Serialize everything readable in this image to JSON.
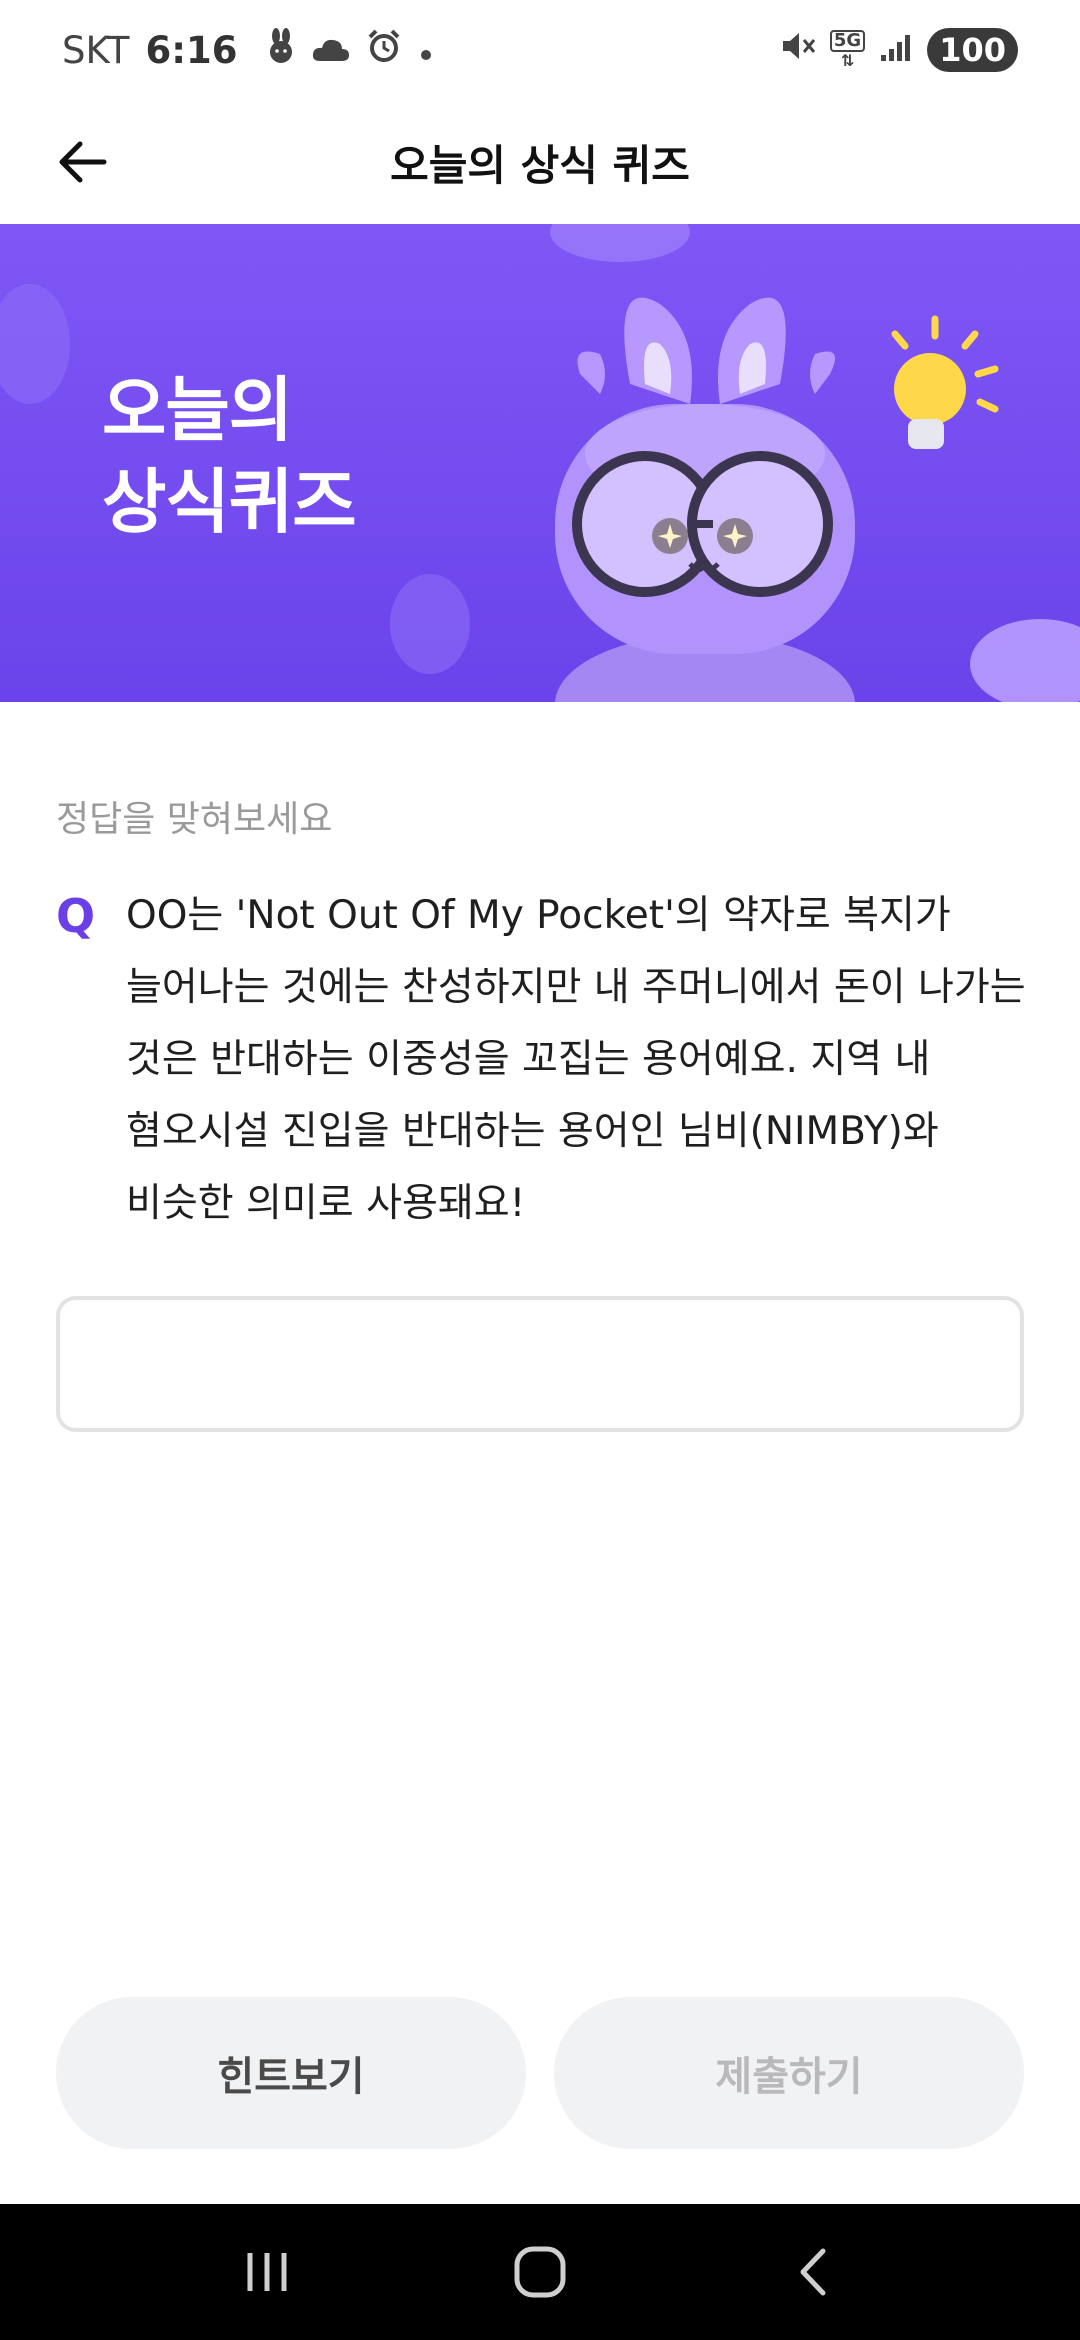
{
  "status_bar": {
    "carrier": "SKT",
    "time": "6:16",
    "network": "5G",
    "battery": "100",
    "icons": [
      "rabbit-icon",
      "cloud-icon",
      "alarm-icon",
      "dot-icon",
      "mute-icon",
      "network-5g-icon",
      "signal-icon",
      "battery-icon"
    ]
  },
  "header": {
    "title": "오늘의 상식 퀴즈",
    "back_icon": "arrow-left-icon"
  },
  "banner": {
    "line1": "오늘의",
    "line2": "상식퀴즈",
    "colors": {
      "bg_top": "#8057f6",
      "bg_bottom": "#6a43ea"
    },
    "art": [
      "rabbit-mascot",
      "glasses",
      "lightbulb-icon",
      "coin"
    ]
  },
  "quiz": {
    "prompt": "정답을 맞혀보세요",
    "q_label": "Q",
    "question": "OO는 'Not Out Of My Pocket'의 약자로 복지가 늘어나는 것에는 찬성하지만 내 주머니에서 돈이 나가는 것은 반대하는 이중성을 꼬집는 용어예요. 지역 내 혐오시설 진입을 반대하는 용어인 님비(NIMBY)와 비슷한 의미로 사용돼요!",
    "answer_value": "",
    "accent": "#6b3fe6"
  },
  "buttons": {
    "hint": "힌트보기",
    "submit": "제출하기"
  },
  "nav": {
    "items": [
      "recent-apps-icon",
      "home-icon",
      "back-icon"
    ]
  }
}
